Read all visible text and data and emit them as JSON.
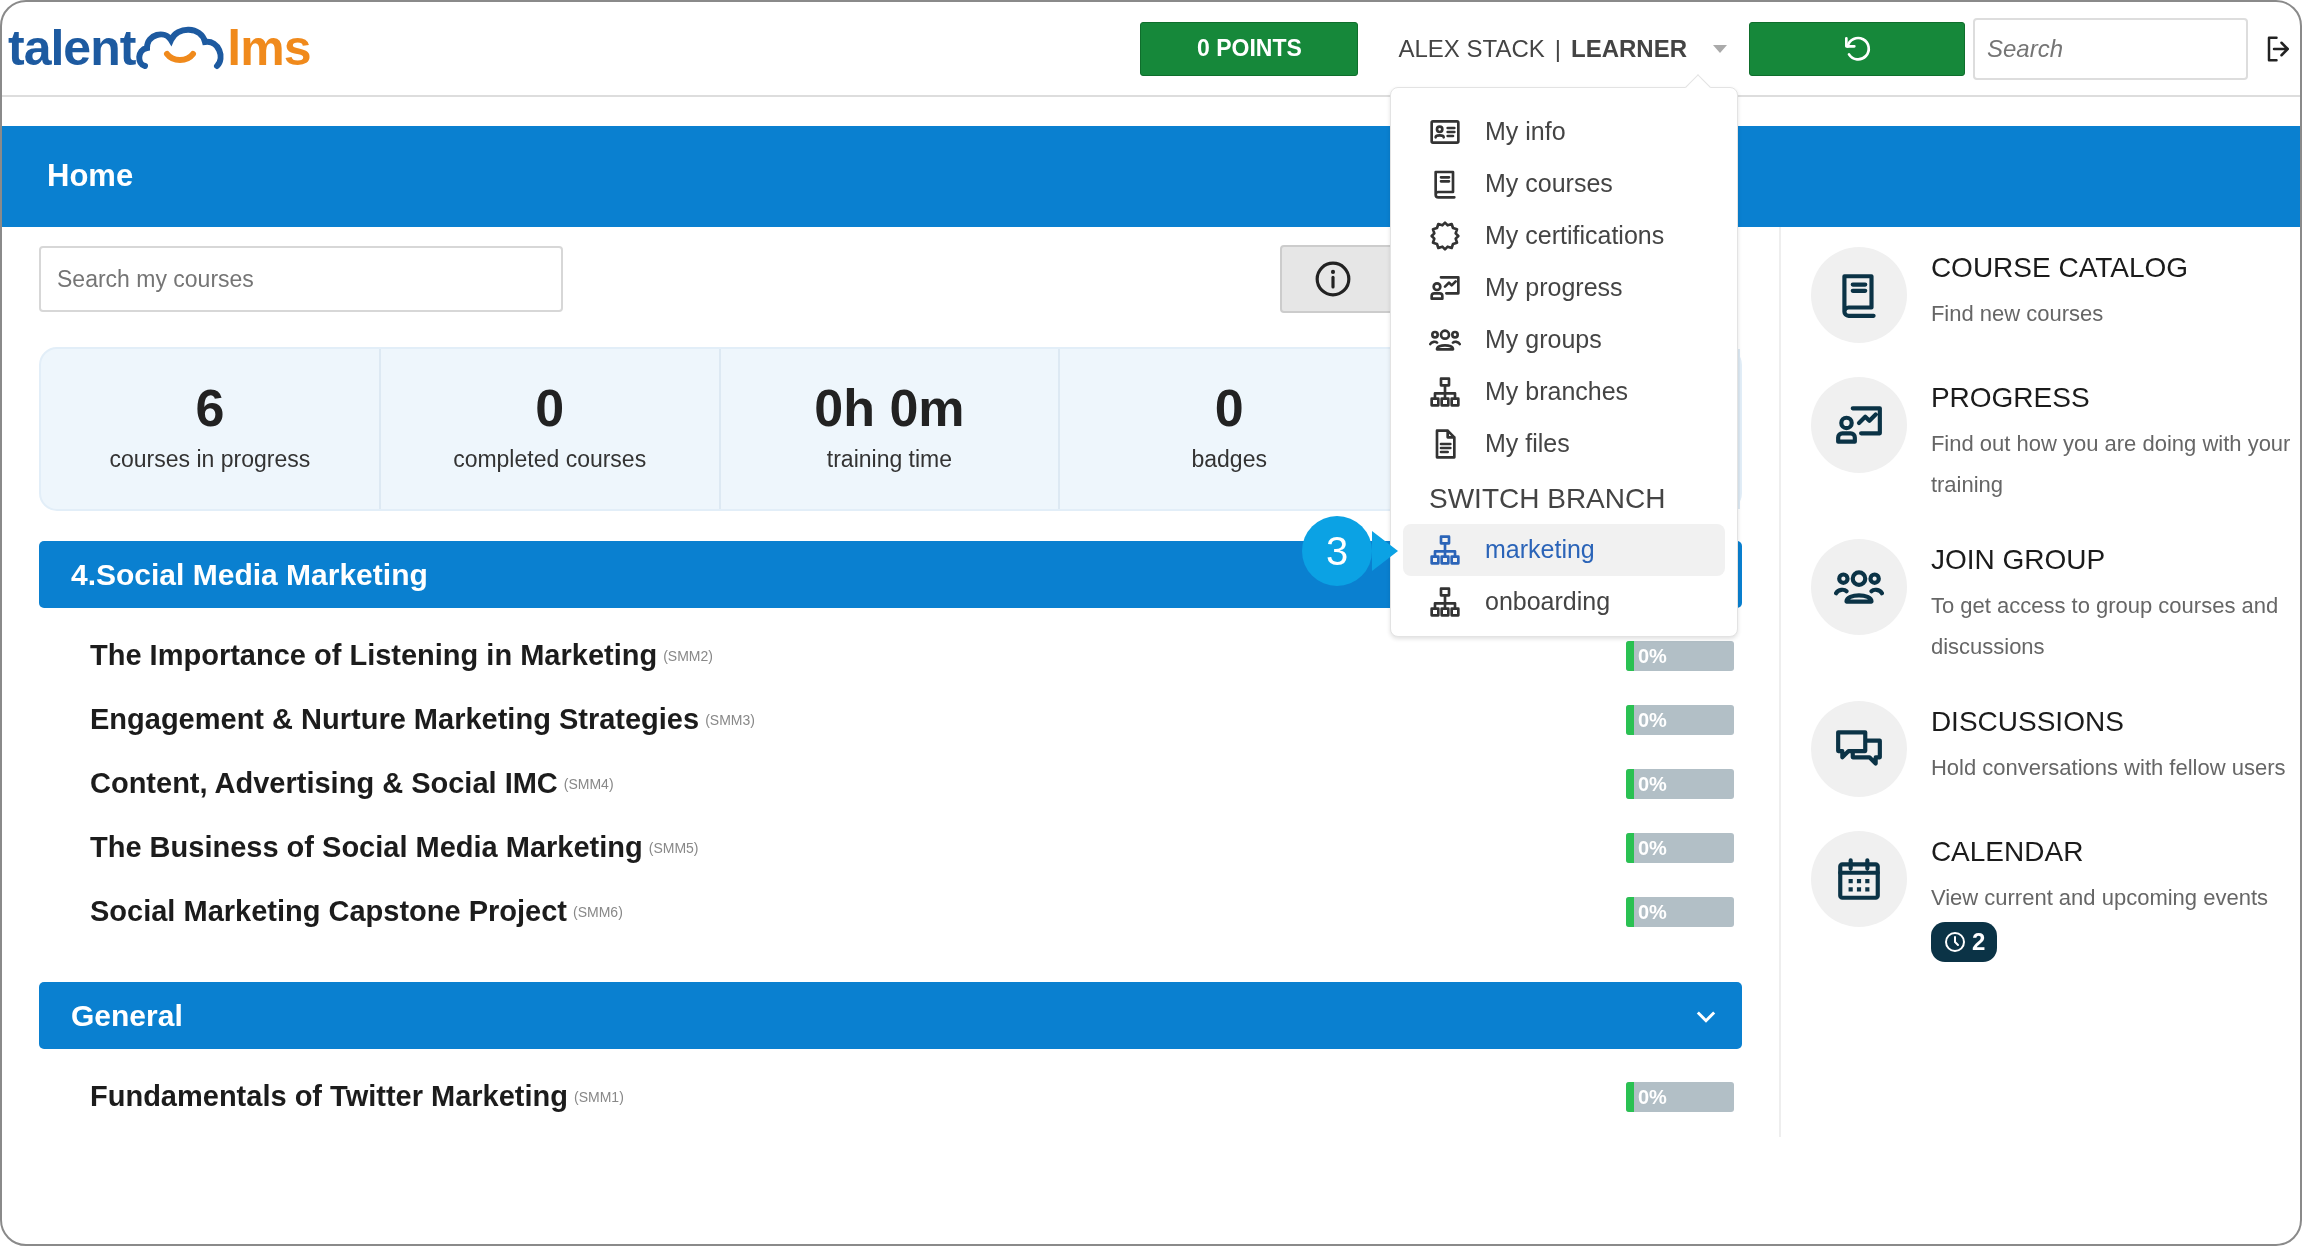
{
  "logo": {
    "part_1": "talent",
    "part_2": "lms"
  },
  "points_button": "0 POINTS",
  "user": {
    "name": "ALEX STACK",
    "separator": "|",
    "role": "LEARNER"
  },
  "search": {
    "placeholder": "Search"
  },
  "page_title": "Home",
  "course_search": {
    "placeholder": "Search my courses"
  },
  "stats": [
    {
      "value": "6",
      "label": "courses in progress"
    },
    {
      "value": "0",
      "label": "completed courses"
    },
    {
      "value": "0h 0m",
      "label": "training time"
    },
    {
      "value": "0",
      "label": "badges"
    }
  ],
  "categories": [
    {
      "title": "4.Social Media Marketing",
      "courses": [
        {
          "title": "The Importance of Listening in Marketing",
          "code": "(SMM2)",
          "progress": "0%",
          "level": 0
        },
        {
          "title": "Engagement & Nurture Marketing Strategies",
          "code": "(SMM3)",
          "progress": "0%",
          "level": 0
        },
        {
          "title": "Content, Advertising & Social IMC",
          "code": "(SMM4)",
          "progress": "0%",
          "level": 0
        },
        {
          "title": "The Business of Social Media Marketing",
          "code": "(SMM5)",
          "progress": "0%",
          "level": 0
        },
        {
          "title": "Social Marketing Capstone Project",
          "code": "(SMM6)",
          "progress": "0%",
          "level": 0
        }
      ]
    },
    {
      "title": "General",
      "expanded": true,
      "courses": [
        {
          "title": "Fundamentals of Twitter Marketing",
          "code": "(SMM1)",
          "progress": "0%",
          "level": 0
        }
      ]
    }
  ],
  "shortcuts": [
    {
      "title": "COURSE CATALOG",
      "description": "Find new courses"
    },
    {
      "title": "PROGRESS",
      "description": "Find out how you are doing with your training"
    },
    {
      "title": "JOIN GROUP",
      "description": "To get access to group courses and discussions"
    },
    {
      "title": "DISCUSSIONS",
      "description": "Hold conversations with fellow users"
    },
    {
      "title": "CALENDAR",
      "description": "View current and upcoming events",
      "badge": "2"
    }
  ],
  "user_menu": {
    "items": [
      {
        "label": "My info"
      },
      {
        "label": "My courses"
      },
      {
        "label": "My certifications"
      },
      {
        "label": "My progress"
      },
      {
        "label": "My groups"
      },
      {
        "label": "My branches"
      },
      {
        "label": "My files"
      }
    ],
    "section_title": "SWITCH BRANCH",
    "branches": [
      {
        "label": "marketing",
        "selected": true
      },
      {
        "label": "onboarding",
        "selected": false
      }
    ]
  },
  "callout": "3"
}
